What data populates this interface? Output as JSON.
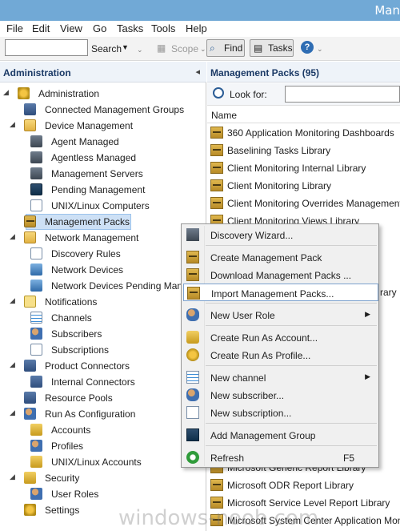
{
  "window": {
    "title": "Man"
  },
  "menubar": {
    "items": [
      "File",
      "Edit",
      "View",
      "Go",
      "Tasks",
      "Tools",
      "Help"
    ]
  },
  "toolbar": {
    "search_value": "",
    "search_label": "Search",
    "scope_label": "Scope",
    "find_label": "Find",
    "tasks_label": "Tasks"
  },
  "nav": {
    "header": "Administration",
    "items": [
      {
        "label": "Administration",
        "level": 0,
        "expander": "◢",
        "icon": "gear-icon"
      },
      {
        "label": "Connected Management Groups",
        "level": 1,
        "expander": "",
        "icon": "connected-groups-icon"
      },
      {
        "label": "Device Management",
        "level": 1,
        "expander": "◢",
        "icon": "folder-icon"
      },
      {
        "label": "Agent Managed",
        "level": 2,
        "expander": "",
        "icon": "agent-icon"
      },
      {
        "label": "Agentless Managed",
        "level": 2,
        "expander": "",
        "icon": "agentless-icon"
      },
      {
        "label": "Management Servers",
        "level": 2,
        "expander": "",
        "icon": "server-icon"
      },
      {
        "label": "Pending Management",
        "level": 2,
        "expander": "",
        "icon": "pending-icon"
      },
      {
        "label": "UNIX/Linux Computers",
        "level": 2,
        "expander": "",
        "icon": "unix-icon"
      },
      {
        "label": "Management Packs",
        "level": 1,
        "expander": "",
        "icon": "management-pack-icon",
        "selected": true
      },
      {
        "label": "Network Management",
        "level": 1,
        "expander": "◢",
        "icon": "folder-icon"
      },
      {
        "label": "Discovery Rules",
        "level": 2,
        "expander": "",
        "icon": "document-icon"
      },
      {
        "label": "Network Devices",
        "level": 2,
        "expander": "",
        "icon": "network-icon"
      },
      {
        "label": "Network Devices Pending Management",
        "level": 2,
        "expander": "",
        "icon": "network-pending-icon"
      },
      {
        "label": "Notifications",
        "level": 1,
        "expander": "◢",
        "icon": "mail-icon"
      },
      {
        "label": "Channels",
        "level": 2,
        "expander": "",
        "icon": "channel-icon"
      },
      {
        "label": "Subscribers",
        "level": 2,
        "expander": "",
        "icon": "subscriber-icon"
      },
      {
        "label": "Subscriptions",
        "level": 2,
        "expander": "",
        "icon": "subscription-icon"
      },
      {
        "label": "Product Connectors",
        "level": 1,
        "expander": "◢",
        "icon": "connector-icon"
      },
      {
        "label": "Internal Connectors",
        "level": 2,
        "expander": "",
        "icon": "connector-icon"
      },
      {
        "label": "Resource Pools",
        "level": 1,
        "expander": "",
        "icon": "resource-pool-icon"
      },
      {
        "label": "Run As Configuration",
        "level": 1,
        "expander": "◢",
        "icon": "run-as-icon"
      },
      {
        "label": "Accounts",
        "level": 2,
        "expander": "",
        "icon": "account-icon"
      },
      {
        "label": "Profiles",
        "level": 2,
        "expander": "",
        "icon": "profile-icon"
      },
      {
        "label": "UNIX/Linux Accounts",
        "level": 2,
        "expander": "",
        "icon": "unix-account-icon"
      },
      {
        "label": "Security",
        "level": 1,
        "expander": "◢",
        "icon": "security-icon"
      },
      {
        "label": "User Roles",
        "level": 2,
        "expander": "",
        "icon": "user-roles-icon"
      },
      {
        "label": "Settings",
        "level": 1,
        "expander": "",
        "icon": "settings-icon"
      }
    ]
  },
  "main": {
    "title": "Management Packs (95)",
    "lookfor_label": "Look for:",
    "column_name": "Name",
    "rows_top": [
      "360 Application Monitoring Dashboards",
      "Baselining Tasks Library",
      "Client Monitoring Internal Library",
      "Client Monitoring Library",
      "Client Monitoring Overrides Management Pack",
      "Client Monitoring Views Library"
    ],
    "rows_peek": [
      "rary"
    ],
    "rows_bottom": [
      "Microsoft Generic Report Library",
      "Microsoft ODR Report Library",
      "Microsoft Service Level Report Library",
      "Microsoft System Center Application Monitoring"
    ]
  },
  "context_menu": {
    "items": [
      {
        "label": "Discovery Wizard...",
        "icon": "discovery-wizard-icon",
        "group": 0
      },
      {
        "label": "Create Management Pack",
        "icon": "create-pack-icon",
        "group": 1
      },
      {
        "label": "Download Management Packs ...",
        "icon": "download-pack-icon",
        "group": 1
      },
      {
        "label": "Import Management Packs...",
        "icon": "import-pack-icon",
        "group": 1,
        "highlighted": true
      },
      {
        "label": "New User Role",
        "icon": "user-role-icon",
        "group": 2,
        "submenu": true
      },
      {
        "label": "Create Run As Account...",
        "icon": "run-as-account-icon",
        "group": 3
      },
      {
        "label": "Create Run As Profile...",
        "icon": "run-as-profile-icon",
        "group": 3
      },
      {
        "label": "New channel",
        "icon": "channel-icon",
        "group": 4,
        "submenu": true
      },
      {
        "label": "New subscriber...",
        "icon": "subscriber-icon",
        "group": 4
      },
      {
        "label": "New subscription...",
        "icon": "subscription-icon",
        "group": 4
      },
      {
        "label": "Add Management Group",
        "icon": "management-group-icon",
        "group": 5
      },
      {
        "label": "Refresh",
        "icon": "refresh-icon",
        "group": 6,
        "shortcut": "F5"
      }
    ]
  },
  "watermark": "windows-noob.com",
  "colors": {
    "titlebar": "#71a9d6",
    "selection": "#cde0f5",
    "header_text": "#1b3a66"
  }
}
